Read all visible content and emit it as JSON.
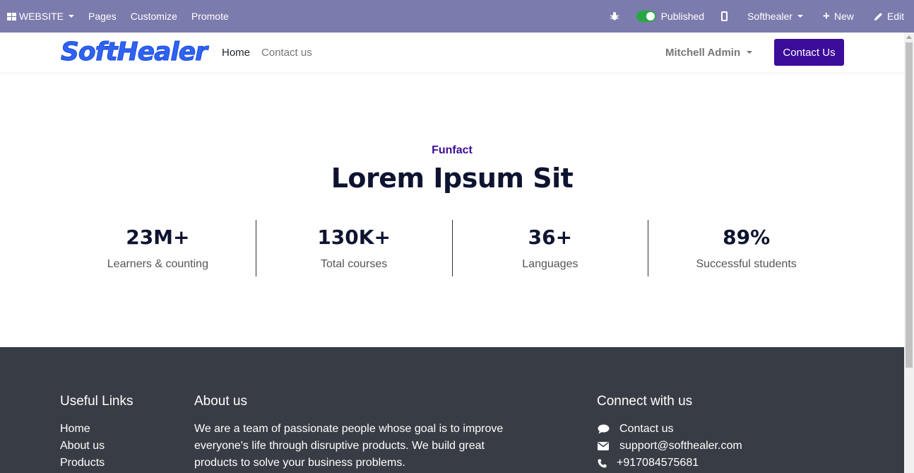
{
  "adminbar": {
    "website_label": "WEBSITE",
    "pages_label": "Pages",
    "customize_label": "Customize",
    "promote_label": "Promote",
    "published_label": "Published",
    "company_label": "Softhealer",
    "new_label": "New",
    "edit_label": "Edit",
    "bg_color": "#7c7bad"
  },
  "header": {
    "logo_text": "SoftHealer",
    "nav": [
      {
        "label": "Home"
      },
      {
        "label": "Contact us"
      }
    ],
    "user_label": "Mitchell Admin",
    "cta_label": "Contact Us",
    "cta_color": "#3c0c9a"
  },
  "funfact": {
    "eyebrow": "Funfact",
    "title": "Lorem Ipsum Sit",
    "stats": [
      {
        "value": "23M+",
        "label": "Learners & counting"
      },
      {
        "value": "130K+",
        "label": "Total courses"
      },
      {
        "value": "36+",
        "label": "Languages"
      },
      {
        "value": "89%",
        "label": "Successful students"
      }
    ]
  },
  "footer": {
    "useful_links_title": "Useful Links",
    "useful_links": [
      "Home",
      "About us",
      "Products"
    ],
    "about_title": "About us",
    "about_lines": [
      "We are a team of passionate people whose goal is to improve",
      "everyone's life through disruptive products. We build great",
      "products to solve your business problems."
    ],
    "connect_title": "Connect with us",
    "connect": [
      {
        "icon": "comment-icon",
        "text": "Contact us"
      },
      {
        "icon": "envelope-icon",
        "text": "support@softhealer.com"
      },
      {
        "icon": "phone-icon",
        "text": "+917084575681"
      }
    ],
    "bg_color": "#383d45"
  }
}
